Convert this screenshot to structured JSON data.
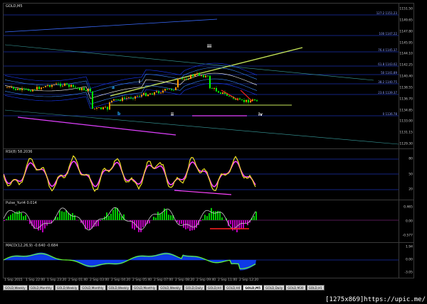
{
  "main_chart": {
    "title": "GOLD,M5",
    "price_labels": [
      "1151.50",
      "1149.65",
      "1147.80",
      "1145.95",
      "1144.10",
      "1142.25",
      "1140.40",
      "1138.55",
      "1136.70",
      "1134.85",
      "1133.00",
      "1131.15",
      "1129.30"
    ],
    "fib_labels": [
      "127.2 1151.23",
      "100 1147.22",
      "76.4 1145.37",
      "61.8 1143.02",
      "50 1141.89",
      "38.2 1140.75",
      "23.6 1139.37",
      "0 1136.78"
    ],
    "wave_labels": [
      "i",
      "ii",
      "iii",
      "iv",
      "a",
      "b"
    ],
    "colors": {
      "bull": "#ff9900",
      "bear": "#00ff00",
      "trend": "#c8e85a",
      "band": "#2b4bff",
      "magenta": "#e040ff"
    }
  },
  "rsi": {
    "title": "RSI(8) 58.2036",
    "levels": [
      "80",
      "50",
      "20"
    ],
    "colors": {
      "line": "#f0e020",
      "signal": "#ff44ff"
    }
  },
  "pulse": {
    "title": "Pulse_Yuri4 0.014",
    "levels": [
      "0.465",
      "0.00",
      "-0.577"
    ],
    "colors": {
      "pos": "#00cc00",
      "neg": "#bb00bb",
      "line": "#cccccc"
    }
  },
  "macd": {
    "title": "MACD(12,26,9) -0.640 -0.684",
    "levels": [
      "1.94",
      "0.00",
      "-3.05"
    ],
    "colors": {
      "hist": "#1040ff",
      "line": "#66ff33"
    }
  },
  "time_axis": [
    "1 Sep 2015",
    "1 Sep 22:00",
    "1 Sep 23:20",
    "2 Sep 01:40",
    "2 Sep 03:00",
    "2 Sep 04:20",
    "2 Sep 05:40",
    "2 Sep 07:00",
    "2 Sep 08:20",
    "2 Sep 09:40",
    "2 Sep 11:00",
    "2 Sep 12:20"
  ],
  "tabs": [
    "GOLD,Weekly",
    "GOLD,Monthly",
    "GOLD,Weekly",
    "GOLD,Monthly",
    "GOLD,Weekly",
    "GOLD,Monthly",
    "GOLD,Weekly",
    "GOLD,Daily",
    "GOLD,H4",
    "GOLD,H4",
    "GOLD,M5",
    "GOLD,Daily",
    "GOLD,M30",
    "GOLD,H1"
  ],
  "active_tab_index": 10,
  "watermark": "[1275x869]https://upic.me/"
}
